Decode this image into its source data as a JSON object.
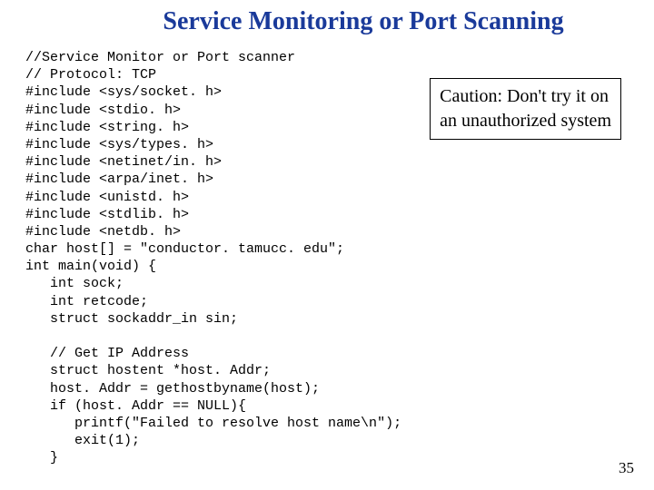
{
  "title": "Service Monitoring or Port Scanning",
  "caution": {
    "line1": "Caution: Don't try it on",
    "line2": "an unauthorized system"
  },
  "code": {
    "l01": "//Service Monitor or Port scanner",
    "l02": "// Protocol: TCP",
    "l03": "#include <sys/socket. h>",
    "l04": "#include <stdio. h>",
    "l05": "#include <string. h>",
    "l06": "#include <sys/types. h>",
    "l07": "#include <netinet/in. h>",
    "l08": "#include <arpa/inet. h>",
    "l09": "#include <unistd. h>",
    "l10": "#include <stdlib. h>",
    "l11": "#include <netdb. h>",
    "l12": "char host[] = \"conductor. tamucc. edu\";",
    "l13": "int main(void) {",
    "l14": "   int sock;",
    "l15": "   int retcode;",
    "l16": "   struct sockaddr_in sin;",
    "l17": "",
    "l18": "   // Get IP Address",
    "l19": "   struct hostent *host. Addr;",
    "l20": "   host. Addr = gethostbyname(host);",
    "l21": "   if (host. Addr == NULL){",
    "l22": "      printf(\"Failed to resolve host name\\n\");",
    "l23": "      exit(1);",
    "l24": "   }"
  },
  "page_number": "35"
}
